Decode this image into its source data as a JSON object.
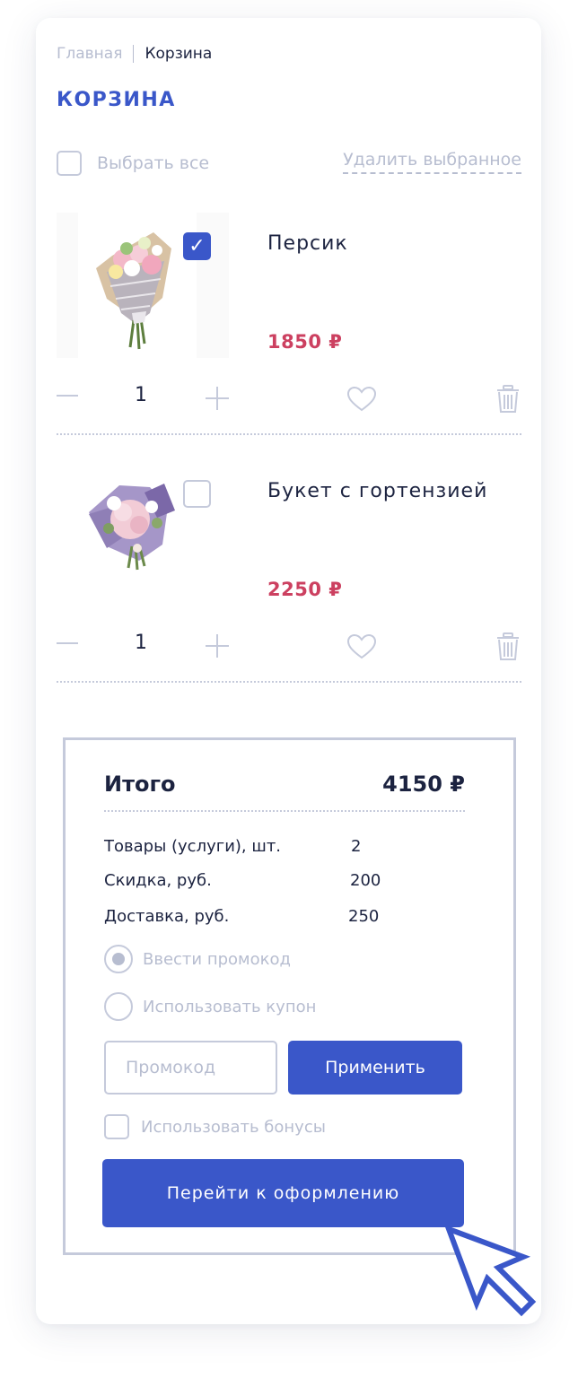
{
  "breadcrumbs": {
    "home": "Главная",
    "current": "Корзина"
  },
  "page_title": "КОРЗИНА",
  "select_all_label": "Выбрать все",
  "delete_selected_label": "Удалить выбранное",
  "items": [
    {
      "name": "Персик",
      "price": "1850 ₽",
      "quantity": "1",
      "selected": true,
      "checkmark": "✓"
    },
    {
      "name": "Букет с гортензией",
      "price": "2250 ₽",
      "quantity": "1",
      "selected": false
    }
  ],
  "summary": {
    "total_label": "Итого",
    "total_value": "4150 ₽",
    "rows": [
      {
        "label": "Товары (услуги), шт.",
        "value": "2"
      },
      {
        "label": "Скидка, руб.",
        "value": "200"
      },
      {
        "label": "Доставка, руб.",
        "value": "250"
      }
    ],
    "promo_options": [
      {
        "label": "Ввести промокод",
        "selected": true
      },
      {
        "label": "Использовать купон",
        "selected": false
      }
    ],
    "promo_placeholder": "Промокод",
    "apply_label": "Применить",
    "bonus_label": "Использовать бонусы",
    "checkout_label": "Перейти к оформлению"
  },
  "colors": {
    "accent": "#3a57c9",
    "price": "#cc4060",
    "muted": "#b7bdd0",
    "border": "#c5cadb",
    "text": "#1c2340"
  },
  "icons": [
    "checkbox-icon",
    "minus-icon",
    "plus-icon",
    "heart-icon",
    "trash-icon",
    "cursor-arrow-icon"
  ]
}
